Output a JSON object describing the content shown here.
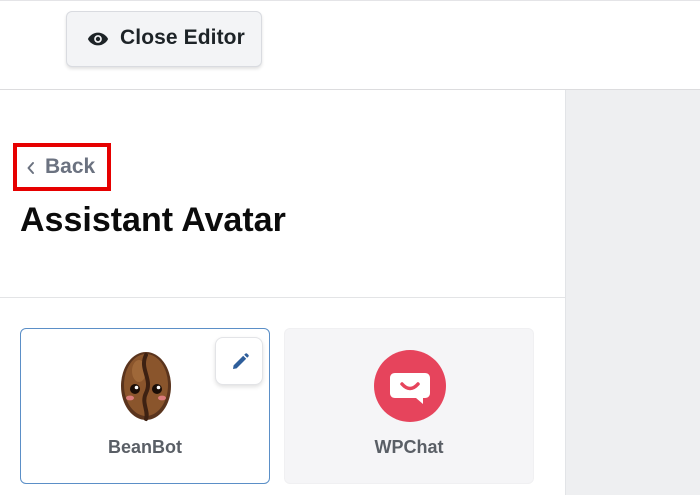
{
  "toolbar": {
    "close_editor_label": "Close Editor",
    "close_editor_icon": "eye-icon"
  },
  "panel": {
    "back_label": "Back",
    "back_icon": "chevron-left-icon",
    "title": "Assistant Avatar"
  },
  "avatars": [
    {
      "name": "BeanBot",
      "icon": "coffee-bean-avatar",
      "selected": true,
      "edit_icon": "pencil-icon"
    },
    {
      "name": "WPChat",
      "icon": "chat-bubble-avatar",
      "selected": false
    }
  ],
  "colors": {
    "highlight_box": "#e60000",
    "selected_border": "#5b8fc7",
    "wpchat_brand": "#e6445c",
    "edit_icon": "#2e5e9b"
  }
}
